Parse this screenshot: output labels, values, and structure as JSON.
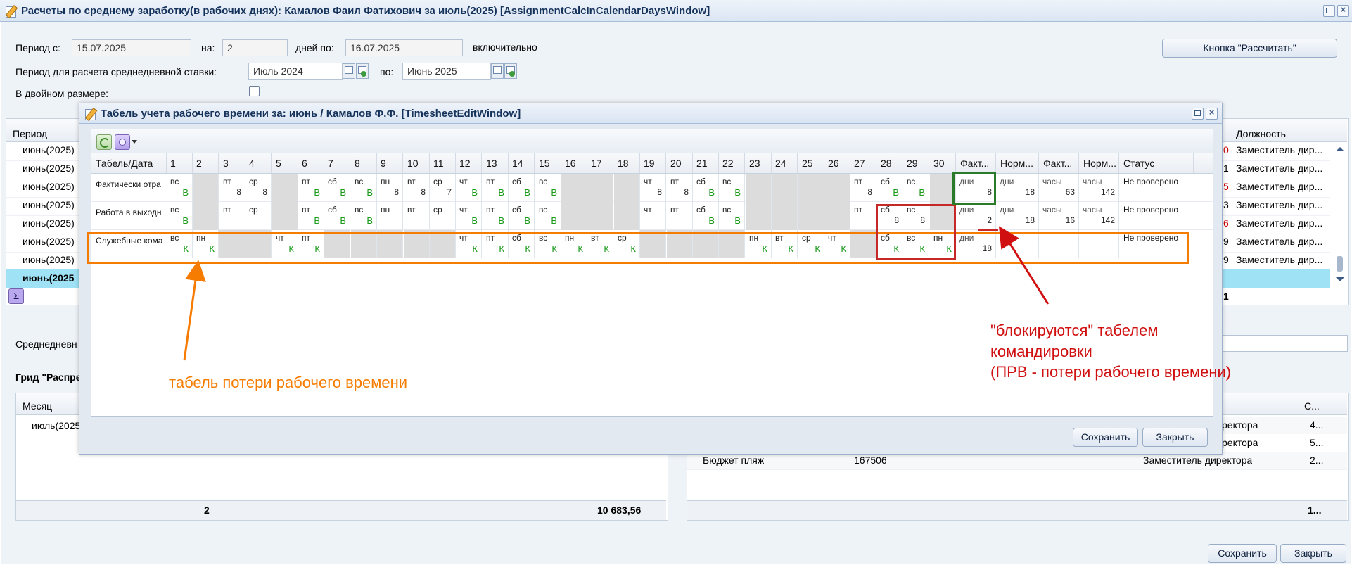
{
  "main_window": {
    "title": "Расчеты по среднему заработку(в рабочих днях): Камалов Фаил Фатихович за июль(2025) [AssignmentCalcInCalendarDaysWindow]"
  },
  "form": {
    "period_from_label": "Период с:",
    "period_from_value": "15.07.2025",
    "on_label": "на:",
    "on_value": "2",
    "days_to_label": "дней по:",
    "days_to_value": "16.07.2025",
    "inclusive_label": "включительно",
    "calc_button": "Кнопка \"Рассчитать\"",
    "rate_period_label": "Период для расчета среднедневной ставки:",
    "rate_from_value": "Июль 2024",
    "rate_to_label": "по:",
    "rate_to_value": "Июнь 2025",
    "double_label": "В двойном размере:"
  },
  "bg_grid": {
    "period_header": "Период",
    "position_header": "Должность",
    "rows": [
      "июнь(2025)",
      "июнь(2025)",
      "июнь(2025)",
      "июнь(2025)",
      "июнь(2025)",
      "июнь(2025)",
      "июнь(2025)"
    ],
    "selected_row": "июнь(2025",
    "right_digits": [
      "0",
      "1",
      "5",
      "3",
      "6",
      "9",
      "9"
    ],
    "positions": [
      "Заместитель дир...",
      "Заместитель дир...",
      "Заместитель дир...",
      "Заместитель дир...",
      "Заместитель дир...",
      "Заместитель дир...",
      "Заместитель дир..."
    ],
    "total_digit": "1",
    "sum_icon": "Σ"
  },
  "avg_label": "Среднедневн",
  "distribution": {
    "title": "Грид \"Распре",
    "month_header": "Месяц",
    "month_row": "июль(2025",
    "total_count": "2",
    "total_amount": "10 683,56",
    "right_header": "С...",
    "right_rows": [
      {
        "name": "",
        "code": "",
        "position": "ректора",
        "amount": "4..."
      },
      {
        "name": "",
        "code": "",
        "position": "ректора",
        "amount": "5..."
      },
      {
        "name": "Бюджет пляж",
        "code": "167506",
        "position": "Заместитель директора",
        "amount": "2..."
      }
    ],
    "right_total": "1..."
  },
  "footer": {
    "save": "Сохранить",
    "close": "Закрыть"
  },
  "timesheet": {
    "title": "Табель учета рабочего времени за: июнь / Камалов Ф.Ф. [TimesheetEditWindow]",
    "first_col": "Табель/Дата",
    "days": [
      "1",
      "2",
      "3",
      "4",
      "5",
      "6",
      "7",
      "8",
      "9",
      "10",
      "11",
      "12",
      "13",
      "14",
      "15",
      "16",
      "17",
      "18",
      "19",
      "20",
      "21",
      "22",
      "23",
      "24",
      "25",
      "26",
      "27",
      "28",
      "29",
      "30"
    ],
    "summary_headers": [
      "Факт...",
      "Норм...",
      "Факт...",
      "Норм...",
      "Статус"
    ],
    "rows": [
      {
        "name": "Фактически отра",
        "cells": [
          {
            "w": "вс",
            "v": "В",
            "g": 1
          },
          {
            "d": 1
          },
          {
            "w": "вт",
            "v": "8"
          },
          {
            "w": "ср",
            "v": "8"
          },
          {
            "d": 1
          },
          {
            "w": "пт",
            "v": "В",
            "g": 1
          },
          {
            "w": "сб",
            "v": "В",
            "g": 1
          },
          {
            "w": "вс",
            "v": "В",
            "g": 1
          },
          {
            "w": "пн",
            "v": "8"
          },
          {
            "w": "вт",
            "v": "8"
          },
          {
            "w": "ср",
            "v": "7"
          },
          {
            "w": "чт",
            "v": "В",
            "g": 1
          },
          {
            "w": "пт",
            "v": "В",
            "g": 1
          },
          {
            "w": "сб",
            "v": "В",
            "g": 1
          },
          {
            "w": "вс",
            "v": "В",
            "g": 1
          },
          {
            "d": 1
          },
          {
            "d": 1
          },
          {
            "d": 1
          },
          {
            "w": "чт",
            "v": "8"
          },
          {
            "w": "пт",
            "v": "8"
          },
          {
            "w": "сб",
            "v": "В",
            "g": 1
          },
          {
            "w": "вс",
            "v": "В",
            "g": 1
          },
          {
            "d": 1
          },
          {
            "d": 1
          },
          {
            "d": 1
          },
          {
            "d": 1
          },
          {
            "w": "пт",
            "v": "8"
          },
          {
            "w": "сб",
            "v": "В",
            "g": 1
          },
          {
            "w": "вс",
            "v": "В",
            "g": 1
          },
          {
            "d": 1
          }
        ],
        "summary": [
          {
            "w": "дни",
            "v": "8"
          },
          {
            "w": "дни",
            "v": "18"
          },
          {
            "w": "часы",
            "v": "63"
          },
          {
            "w": "часы",
            "v": "142"
          }
        ],
        "status": "Не проверено"
      },
      {
        "name": "Работа в выходн",
        "cells": [
          {
            "w": "вс",
            "v": "В",
            "g": 1
          },
          {
            "d": 1
          },
          {
            "w": "вт",
            "v": ""
          },
          {
            "w": "ср",
            "v": ""
          },
          {
            "d": 1
          },
          {
            "w": "пт",
            "v": "В",
            "g": 1
          },
          {
            "w": "сб",
            "v": "В",
            "g": 1
          },
          {
            "w": "вс",
            "v": "В",
            "g": 1
          },
          {
            "w": "пн",
            "v": ""
          },
          {
            "w": "вт",
            "v": ""
          },
          {
            "w": "ср",
            "v": ""
          },
          {
            "w": "чт",
            "v": "В",
            "g": 1
          },
          {
            "w": "пт",
            "v": "В",
            "g": 1
          },
          {
            "w": "сб",
            "v": "В",
            "g": 1
          },
          {
            "w": "вс",
            "v": "В",
            "g": 1
          },
          {
            "d": 1
          },
          {
            "d": 1
          },
          {
            "d": 1
          },
          {
            "w": "чт",
            "v": ""
          },
          {
            "w": "пт",
            "v": ""
          },
          {
            "w": "сб",
            "v": "В",
            "g": 1
          },
          {
            "w": "вс",
            "v": "В",
            "g": 1
          },
          {
            "d": 1
          },
          {
            "d": 1
          },
          {
            "d": 1
          },
          {
            "d": 1
          },
          {
            "w": "пт",
            "v": ""
          },
          {
            "w": "сб",
            "v": "8"
          },
          {
            "w": "вс",
            "v": "8"
          },
          {
            "d": 1
          }
        ],
        "summary": [
          {
            "w": "дни",
            "v": "2"
          },
          {
            "w": "дни",
            "v": "18"
          },
          {
            "w": "часы",
            "v": "16"
          },
          {
            "w": "часы",
            "v": "142"
          }
        ],
        "status": "Не проверено"
      },
      {
        "name": "Служебные кома",
        "cells": [
          {
            "w": "вс",
            "v": "К",
            "g": 1
          },
          {
            "w": "пн",
            "v": "К",
            "g": 1
          },
          {
            "d": 1
          },
          {
            "d": 1
          },
          {
            "w": "чт",
            "v": "К",
            "g": 1
          },
          {
            "w": "пт",
            "v": "К",
            "g": 1
          },
          {
            "d": 1
          },
          {
            "d": 1
          },
          {
            "d": 1
          },
          {
            "d": 1
          },
          {
            "d": 1
          },
          {
            "w": "чт",
            "v": "К",
            "g": 1
          },
          {
            "w": "пт",
            "v": "К",
            "g": 1
          },
          {
            "w": "сб",
            "v": "К",
            "g": 1
          },
          {
            "w": "вс",
            "v": "К",
            "g": 1
          },
          {
            "w": "пн",
            "v": "К",
            "g": 1
          },
          {
            "w": "вт",
            "v": "К",
            "g": 1
          },
          {
            "w": "ср",
            "v": "К",
            "g": 1
          },
          {
            "d": 1
          },
          {
            "d": 1
          },
          {
            "d": 1
          },
          {
            "d": 1
          },
          {
            "w": "пн",
            "v": "К",
            "g": 1
          },
          {
            "w": "вт",
            "v": "К",
            "g": 1
          },
          {
            "w": "ср",
            "v": "К",
            "g": 1
          },
          {
            "w": "чт",
            "v": "К",
            "g": 1
          },
          {
            "d": 1
          },
          {
            "w": "сб",
            "v": "К",
            "g": 1
          },
          {
            "w": "вс",
            "v": "К",
            "g": 1
          },
          {
            "w": "пн",
            "v": "К",
            "g": 1
          }
        ],
        "summary": [
          {
            "w": "дни",
            "v": "18"
          },
          {
            "w": "",
            "v": ""
          },
          {
            "w": "",
            "v": ""
          },
          {
            "w": "",
            "v": ""
          }
        ],
        "status": "Не проверено"
      }
    ],
    "save": "Сохранить",
    "close": "Закрыть"
  },
  "annotations": {
    "orange_text": "табель потери рабочего времени",
    "red_line1": "\"блокируются\" табелем",
    "red_line2": "командировки",
    "red_line3": "(ПРВ - потери рабочего времени)",
    "colors": {
      "orange": "#f57c00",
      "red": "#d01010",
      "green": "#2a7a2a",
      "crimson": "#c62828"
    }
  }
}
